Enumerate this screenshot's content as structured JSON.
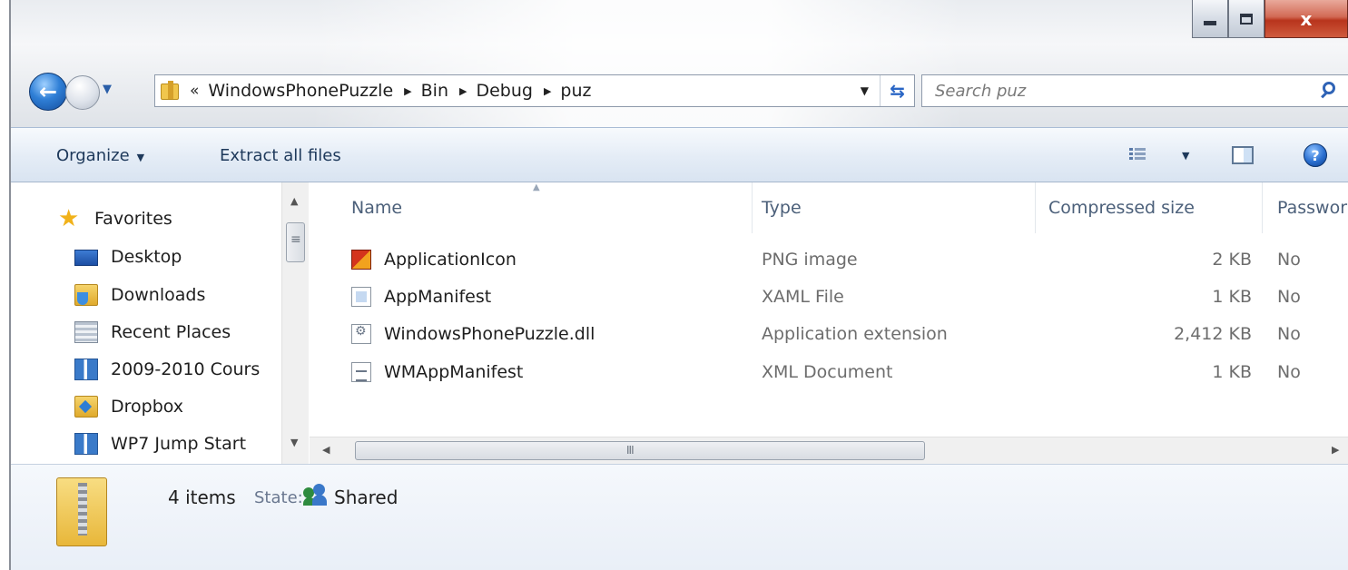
{
  "window": {
    "caption": {
      "minimize": "",
      "maximize": "",
      "close": "x"
    }
  },
  "nav": {
    "breadcrumb_overflow": "«",
    "breadcrumb": [
      "WindowsPhonePuzzle",
      "Bin",
      "Debug",
      "puz"
    ],
    "search_placeholder": "Search puz"
  },
  "toolbar": {
    "organize_label": "Organize",
    "extract_label": "Extract all files"
  },
  "sidebar": {
    "favorites_label": "Favorites",
    "items": [
      {
        "label": "Desktop",
        "icon": "desktop-icon"
      },
      {
        "label": "Downloads",
        "icon": "downloads-folder-icon"
      },
      {
        "label": "Recent Places",
        "icon": "recent-places-icon"
      },
      {
        "label": "2009-2010 Cours",
        "icon": "library-icon"
      },
      {
        "label": "Dropbox",
        "icon": "dropbox-folder-icon"
      },
      {
        "label": "WP7 Jump Start",
        "icon": "library-icon"
      }
    ]
  },
  "columns": {
    "name": "Name",
    "type": "Type",
    "compressed_size": "Compressed size",
    "password": "Passwor"
  },
  "files": [
    {
      "name": "ApplicationIcon",
      "type": "PNG image",
      "size": "2 KB",
      "password": "No",
      "icon": "png-image-icon"
    },
    {
      "name": "AppManifest",
      "type": "XAML File",
      "size": "1 KB",
      "password": "No",
      "icon": "xaml-file-icon"
    },
    {
      "name": "WindowsPhonePuzzle.dll",
      "type": "Application extension",
      "size": "2,412 KB",
      "password": "No",
      "icon": "dll-file-icon"
    },
    {
      "name": "WMAppManifest",
      "type": "XML Document",
      "size": "1 KB",
      "password": "No",
      "icon": "xml-document-icon"
    }
  ],
  "details": {
    "count": "4 items",
    "state_label": "State:",
    "state_value": "Shared"
  },
  "colors": {
    "accent": "#2f63b6",
    "close_button": "#c94a30",
    "folder": "#f0c64d"
  }
}
